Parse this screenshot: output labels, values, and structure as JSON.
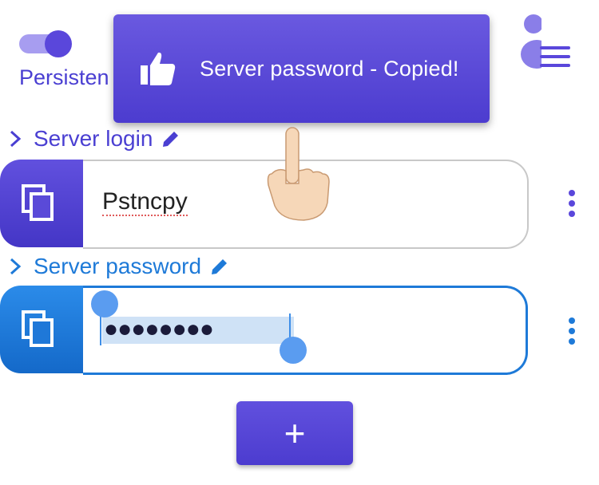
{
  "persistence": {
    "label": "Persisten",
    "toggle_on": true
  },
  "toast": {
    "message": "Server password - Copied!",
    "icon": "thumbs-up-icon"
  },
  "fields": [
    {
      "label": "Server login",
      "value": "Pstncpy",
      "icon": "copy-icon"
    },
    {
      "label": "Server password",
      "value": "●●●●●●●●",
      "icon": "copy-icon"
    }
  ],
  "add_button": {
    "label": "+"
  },
  "colors": {
    "primary": "#5a47db",
    "secondary": "#1e7ad8",
    "toast": "#5543d4"
  },
  "icons": [
    "menu-icon",
    "chevron-right-icon",
    "pencil-icon",
    "copy-icon",
    "kebab-icon",
    "thumbs-up-icon",
    "pointing-hand-icon"
  ]
}
